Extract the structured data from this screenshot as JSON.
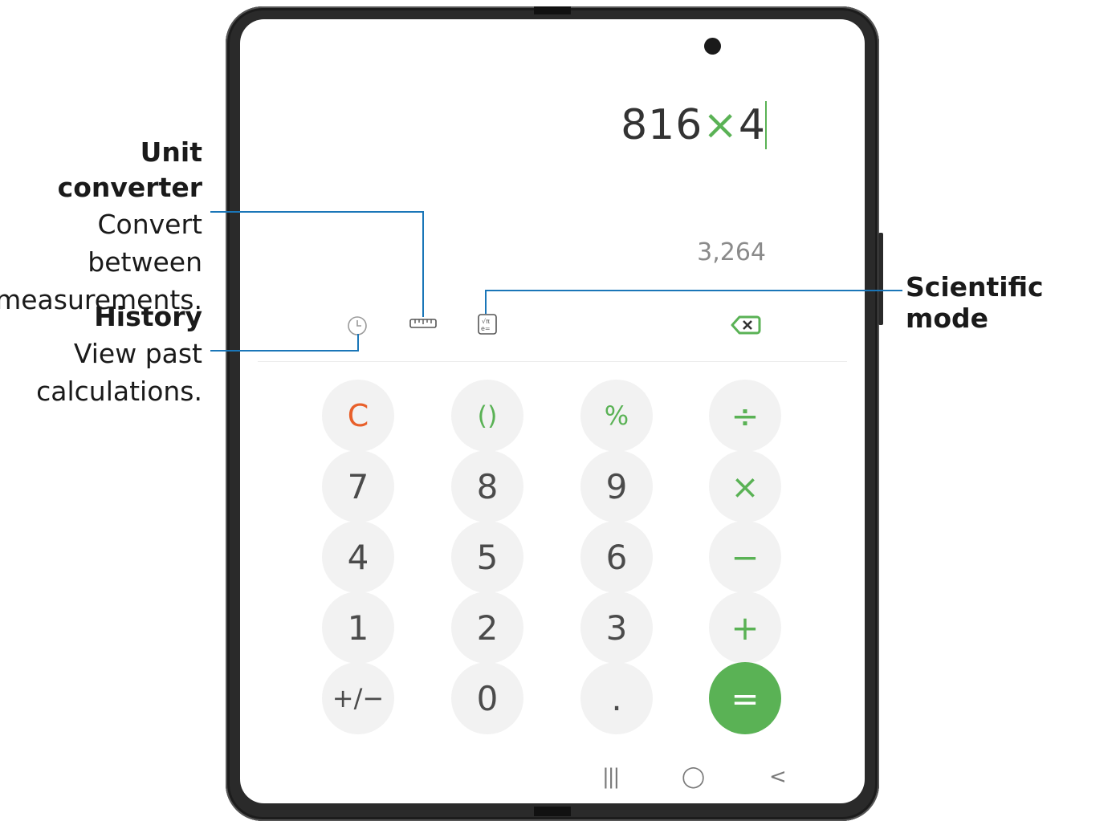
{
  "display": {
    "expression_number1": "816",
    "expression_operator": "×",
    "expression_number2": "4",
    "result": "3,264"
  },
  "toolbar": {
    "history_icon": "clock-icon",
    "unit_converter_icon": "ruler-icon",
    "scientific_icon": "scientific-calculator-icon",
    "backspace_icon": "backspace-icon"
  },
  "keypad": {
    "row1": [
      "C",
      "()",
      "%",
      "÷"
    ],
    "row2": [
      "7",
      "8",
      "9",
      "×"
    ],
    "row3": [
      "4",
      "5",
      "6",
      "−"
    ],
    "row4": [
      "1",
      "2",
      "3",
      "+"
    ],
    "row5": [
      "+/−",
      "0",
      ".",
      "="
    ]
  },
  "navbar": {
    "recents": "|||",
    "home": "◯",
    "back": "<"
  },
  "annotations": {
    "unit_converter": {
      "title": "Unit converter",
      "desc_line1": "Convert",
      "desc_line2": "between",
      "desc_line3": "measurements."
    },
    "history": {
      "title": "History",
      "desc_line1": "View past",
      "desc_line2": "calculations."
    },
    "scientific": {
      "title": "Scientific mode"
    }
  },
  "colors": {
    "accent_green": "#5ab255",
    "clear_red": "#e8602b",
    "callout_blue": "#1a76b8"
  }
}
